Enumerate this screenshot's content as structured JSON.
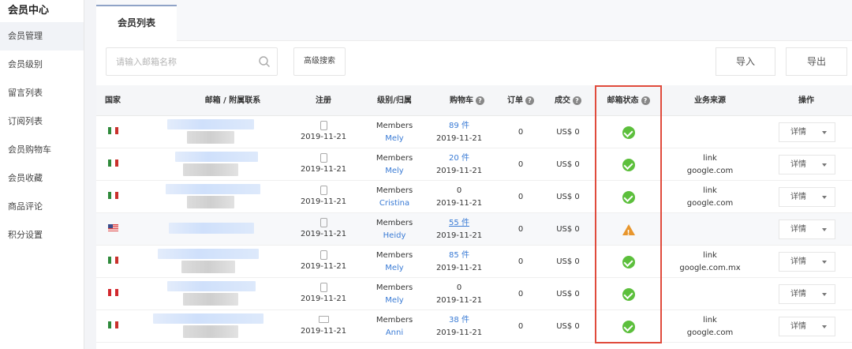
{
  "sidebar": {
    "title": "会员中心",
    "items": [
      {
        "label": "会员管理",
        "active": true
      },
      {
        "label": "会员级别",
        "active": false
      },
      {
        "label": "留言列表",
        "active": false
      },
      {
        "label": "订阅列表",
        "active": false
      },
      {
        "label": "会员购物车",
        "active": false
      },
      {
        "label": "会员收藏",
        "active": false
      },
      {
        "label": "商品评论",
        "active": false
      },
      {
        "label": "积分设置",
        "active": false
      }
    ]
  },
  "tab": {
    "label": "会员列表"
  },
  "toolbar": {
    "search_placeholder": "请输入邮箱名称",
    "advanced_label": "高级搜索",
    "import_label": "导入",
    "export_label": "导出"
  },
  "columns": {
    "country": "国家",
    "email": "邮箱 / 附属联系",
    "register": "注册",
    "level": "级别/归属",
    "cart": "购物车",
    "orders": "订单",
    "deals": "成交",
    "email_status": "邮箱状态",
    "source": "业务来源",
    "action": "操作"
  },
  "colors": {
    "accent_link": "#3a7bd5",
    "status_ok": "#5cbf3c",
    "status_warn": "#e8962d",
    "highlight_box": "#e04b3c"
  },
  "rows": [
    {
      "flag": "MX",
      "device": "mobile-icon",
      "date": "2019-11-21",
      "level": "Members",
      "owner": "Mely",
      "cart": "89 件",
      "cart_link": true,
      "cart_underline": false,
      "cart_date": "2019-11-21",
      "orders": "0",
      "deals": "US$ 0",
      "status": "ok",
      "source1": "",
      "source2": "",
      "action": "详情"
    },
    {
      "flag": "MX",
      "device": "mobile-icon",
      "date": "2019-11-21",
      "level": "Members",
      "owner": "Mely",
      "cart": "20 件",
      "cart_link": true,
      "cart_underline": false,
      "cart_date": "2019-11-21",
      "orders": "0",
      "deals": "US$ 0",
      "status": "ok",
      "source1": "link",
      "source2": "google.com",
      "action": "详情"
    },
    {
      "flag": "MX",
      "device": "mobile-icon",
      "date": "2019-11-21",
      "level": "Members",
      "owner": "Cristina",
      "cart": "0",
      "cart_link": false,
      "cart_underline": false,
      "cart_date": "2019-11-21",
      "orders": "0",
      "deals": "US$ 0",
      "status": "ok",
      "source1": "link",
      "source2": "google.com",
      "action": "详情"
    },
    {
      "flag": "US",
      "device": "mobile-icon",
      "date": "2019-11-21",
      "level": "Members",
      "owner": "Heidy",
      "cart": "55 件",
      "cart_link": true,
      "cart_underline": true,
      "cart_date": "2019-11-21",
      "orders": "0",
      "deals": "US$ 0",
      "status": "warn",
      "source1": "",
      "source2": "",
      "action": "详情"
    },
    {
      "flag": "MX",
      "device": "mobile-icon",
      "date": "2019-11-21",
      "level": "Members",
      "owner": "Mely",
      "cart": "85 件",
      "cart_link": true,
      "cart_underline": false,
      "cart_date": "2019-11-21",
      "orders": "0",
      "deals": "US$ 0",
      "status": "ok",
      "source1": "link",
      "source2": "google.com.mx",
      "action": "详情"
    },
    {
      "flag": "PE",
      "device": "mobile-icon",
      "date": "2019-11-21",
      "level": "Members",
      "owner": "Mely",
      "cart": "0",
      "cart_link": false,
      "cart_underline": false,
      "cart_date": "2019-11-21",
      "orders": "0",
      "deals": "US$ 0",
      "status": "ok",
      "source1": "",
      "source2": "",
      "action": "详情"
    },
    {
      "flag": "MX",
      "device": "desktop-icon",
      "date": "2019-11-21",
      "level": "Members",
      "owner": "Anni",
      "cart": "38 件",
      "cart_link": true,
      "cart_underline": false,
      "cart_date": "2019-11-21",
      "orders": "0",
      "deals": "US$ 0",
      "status": "ok",
      "source1": "link",
      "source2": "google.com",
      "action": "详情"
    }
  ]
}
